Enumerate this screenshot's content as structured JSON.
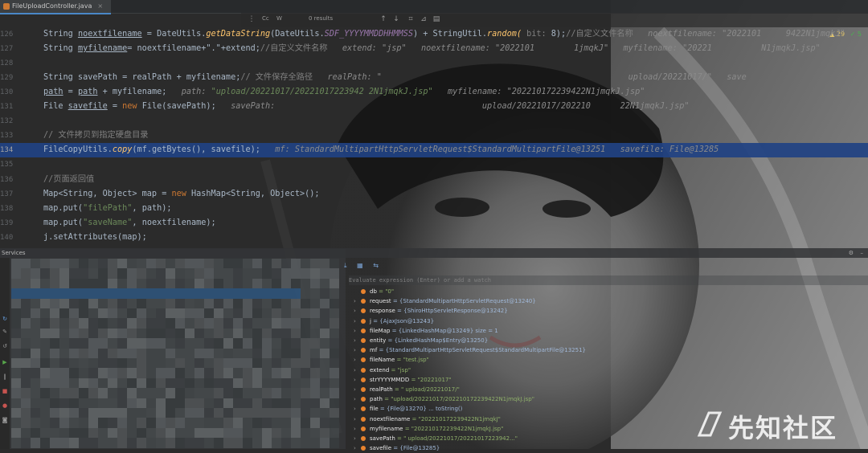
{
  "tab": {
    "title": "FileUploadController.java"
  },
  "find_bar": {
    "cc": "Cc",
    "w": "W",
    "results": "0 results"
  },
  "inspections": {
    "warnings": "29",
    "ok": "5"
  },
  "lines": [
    {
      "num": "126",
      "highlight": false,
      "parts": [
        {
          "t": "String ",
          "c": ""
        },
        {
          "t": "noextfilename",
          "c": "ul"
        },
        {
          "t": " = DateUtils.",
          "c": ""
        },
        {
          "t": "getDataString",
          "c": "fn"
        },
        {
          "t": "(DateUtils.",
          "c": ""
        },
        {
          "t": "SDF_YYYYMMDDHHMMSS",
          "c": "cn"
        },
        {
          "t": ") + StringUtil.",
          "c": ""
        },
        {
          "t": "random(",
          "c": "fn"
        },
        {
          "t": " bit: ",
          "c": "gray"
        },
        {
          "t": "8);",
          "c": ""
        },
        {
          "t": "//自定义文件名称   ",
          "c": "cm"
        },
        {
          "t": "noextfilename: \"2022101     9422N1jmqkJ\"",
          "c": "dbg"
        }
      ]
    },
    {
      "num": "127",
      "highlight": false,
      "parts": [
        {
          "t": "String ",
          "c": ""
        },
        {
          "t": "myfilename",
          "c": "ul"
        },
        {
          "t": "= noextfilename+\".\"+extend;",
          "c": ""
        },
        {
          "t": "//自定义文件名称   ",
          "c": "cm"
        },
        {
          "t": "extend: \"jsp\"   noextfilename: \"2022101        1jmqkJ\"   myfilename: \"20221          N1jmqkJ.jsp\"",
          "c": "dbg"
        }
      ]
    },
    {
      "num": "128",
      "highlight": false,
      "parts": []
    },
    {
      "num": "129",
      "highlight": false,
      "parts": [
        {
          "t": "String savePath = realPath + myfilename;",
          "c": ""
        },
        {
          "t": "// 文件保存全路径   ",
          "c": "cm"
        },
        {
          "t": "realPath: \"                                                  upload/20221017/\"   save",
          "c": "dbg"
        }
      ]
    },
    {
      "num": "130",
      "highlight": false,
      "parts": [
        {
          "t": "path",
          "c": "ul"
        },
        {
          "t": " = ",
          "c": ""
        },
        {
          "t": "path",
          "c": "ul"
        },
        {
          "t": " + myfilename;   ",
          "c": ""
        },
        {
          "t": "path: ",
          "c": "dbg"
        },
        {
          "t": "\"upload/20221017/20221017223942 2N1jmqkJ.jsp\"",
          "c": "dbgv"
        },
        {
          "t": "   myfilename: \"202210172239422N1jmqkJ.jsp\"",
          "c": "dbg"
        }
      ]
    },
    {
      "num": "131",
      "highlight": false,
      "parts": [
        {
          "t": "File ",
          "c": ""
        },
        {
          "t": "savefile",
          "c": "ul"
        },
        {
          "t": " = ",
          "c": ""
        },
        {
          "t": "new ",
          "c": "kw"
        },
        {
          "t": "File(savePath);   ",
          "c": ""
        },
        {
          "t": "savePath:                                          upload/20221017/202210      22N1jmqkJ.jsp\"",
          "c": "dbg"
        }
      ]
    },
    {
      "num": "132",
      "highlight": false,
      "parts": []
    },
    {
      "num": "133",
      "highlight": false,
      "parts": [
        {
          "t": "// 文件拷贝到指定硬盘目录",
          "c": "cm"
        }
      ]
    },
    {
      "num": "134",
      "highlight": true,
      "parts": [
        {
          "t": "FileCopyUtils.",
          "c": ""
        },
        {
          "t": "copy",
          "c": "fn"
        },
        {
          "t": "(mf.getBytes(), savefile);   ",
          "c": ""
        },
        {
          "t": "mf: StandardMultipartHttpServletRequest$StandardMultipartFile@13251   savefile: File@13285",
          "c": "dbg"
        }
      ]
    },
    {
      "num": "135",
      "highlight": false,
      "parts": []
    },
    {
      "num": "136",
      "highlight": false,
      "parts": [
        {
          "t": "//页面返回值",
          "c": "cm"
        }
      ]
    },
    {
      "num": "137",
      "highlight": false,
      "parts": [
        {
          "t": "Map<String, Object> map = ",
          "c": ""
        },
        {
          "t": "new ",
          "c": "kw"
        },
        {
          "t": "HashMap<String, Object>();",
          "c": ""
        }
      ]
    },
    {
      "num": "138",
      "highlight": false,
      "parts": [
        {
          "t": "map.put(",
          "c": ""
        },
        {
          "t": "\"filePath\"",
          "c": "str"
        },
        {
          "t": ", path);",
          "c": ""
        }
      ]
    },
    {
      "num": "139",
      "highlight": false,
      "parts": [
        {
          "t": "map.put(",
          "c": ""
        },
        {
          "t": "\"saveName\"",
          "c": "str"
        },
        {
          "t": ", noextfilename);",
          "c": ""
        }
      ]
    },
    {
      "num": "140",
      "highlight": false,
      "parts": [
        {
          "t": "j.setAttributes(map);",
          "c": ""
        }
      ]
    }
  ],
  "services": {
    "title": "Services"
  },
  "debugger": {
    "eval_placeholder": "Evaluate expression (Enter) or add a watch",
    "variables": [
      {
        "name": "db",
        "value": " = \"0\"",
        "expand": false
      },
      {
        "name": "request",
        "value": " = {StandardMultipartHttpServletRequest@13240}",
        "expand": true
      },
      {
        "name": "response",
        "value": " = {ShiroHttpServletResponse@13242}",
        "expand": true
      },
      {
        "name": "j",
        "value": " = {AjaxJson@13243}",
        "expand": true
      },
      {
        "name": "fileMap",
        "value": " = {LinkedHashMap@13249}  size = 1",
        "expand": true
      },
      {
        "name": "entity",
        "value": " = {LinkedHashMap$Entry@13250}",
        "expand": true
      },
      {
        "name": "mf",
        "value": " = {StandardMultipartHttpServletRequest$StandardMultipartFile@13251}",
        "expand": true
      },
      {
        "name": "fileName",
        "value": " = \"test.jsp\"",
        "expand": true
      },
      {
        "name": "extend",
        "value": " = \"jsp\"",
        "expand": true
      },
      {
        "name": "strYYYYMMDD",
        "value": " = \"20221017\"",
        "expand": true
      },
      {
        "name": "realPath",
        "value": " = \"                                                  upload/20221017/\"",
        "expand": true
      },
      {
        "name": "path",
        "value": " = \"upload/20221017/202210172239422N1jmqkJ.jsp\"",
        "expand": true
      },
      {
        "name": "file",
        "value": " = {File@13270} ... toString()",
        "expand": true
      },
      {
        "name": "noextfilename",
        "value": " = \"202210172239422N1jmqkJ\"",
        "expand": true
      },
      {
        "name": "myfilename",
        "value": " = \"202210172239422N1jmqkJ.jsp\"",
        "expand": true
      },
      {
        "name": "savePath",
        "value": " = \"                                                  upload/20221017/20221017223942...\"",
        "expand": true
      },
      {
        "name": "savefile",
        "value": " = {File@13285}",
        "expand": true
      }
    ]
  },
  "watermark": {
    "text": "先知社区"
  }
}
